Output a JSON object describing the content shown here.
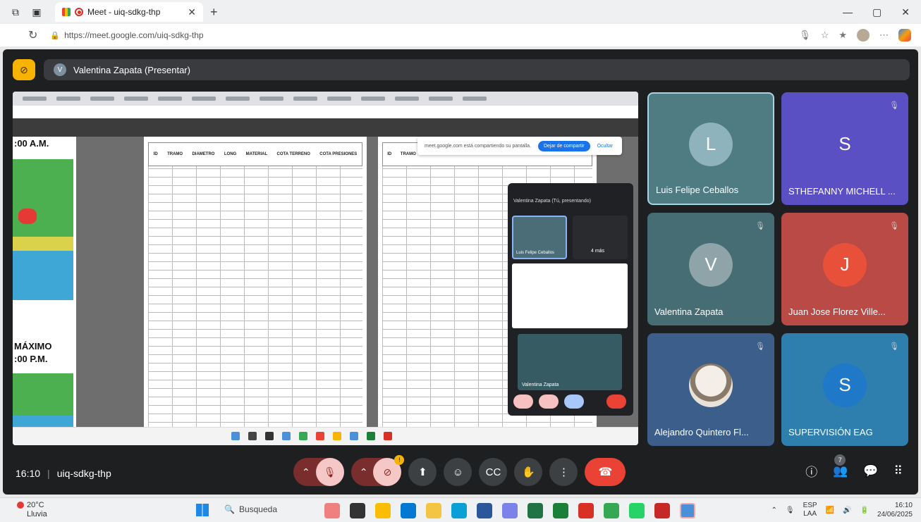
{
  "browser": {
    "tab_title": "Meet - uiq-sdkg-thp",
    "url": "https://meet.google.com/uiq-sdkg-thp"
  },
  "meet": {
    "presenter_label": "Valentina Zapata (Presentar)",
    "presenter_initial": "V",
    "time": "16:10",
    "meeting_code": "uiq-sdkg-thp",
    "people_count": "7",
    "reactions_badge": "!"
  },
  "shared_screen": {
    "heading_1": ":00 A.M.",
    "heading_2": "MÁXIMO",
    "heading_3": ":00 P.M.",
    "share_notice": "meet.google.com está compartiendo su pantalla.",
    "stop_share": "Dejar de compartir",
    "hide": "Ocultar",
    "mini_presenter": "Valentina Zapata (Tú, presentando)",
    "mini_tile_name": "Luis Felipe Ceballos",
    "mini_more": "4 más",
    "mini_self_name": "Valentina Zapata",
    "table_headers": [
      "ID",
      "TRAMO",
      "DIAMETRO",
      "LONG",
      "MATERIAL",
      "COTA TERRENO",
      "COTA PRESIONES"
    ]
  },
  "participants": [
    {
      "name": "Luis Felipe Ceballos",
      "initial": "L",
      "bg": "#4f7b83",
      "avatar": "#8fb3bd",
      "muted": false
    },
    {
      "name": "STHEFANNY MICHELL ...",
      "initial": "S",
      "bg": "#5b4fc4",
      "avatar": "#5b4fc4",
      "muted": true
    },
    {
      "name": "Valentina Zapata",
      "initial": "V",
      "bg": "#466d74",
      "avatar": "#8ea4a8",
      "muted": true
    },
    {
      "name": "Juan Jose Florez Ville...",
      "initial": "J",
      "bg": "#b94a45",
      "avatar": "#e8503a",
      "muted": true
    },
    {
      "name": "Alejandro Quintero Fl...",
      "initial": "",
      "bg": "#3b5f8a",
      "avatar": "#d9d2c6",
      "muted": true
    },
    {
      "name": "SUPERVISIÓN EAG",
      "initial": "S",
      "bg": "#2f7fae",
      "avatar": "#1f78c8",
      "muted": true
    }
  ],
  "taskbar": {
    "temperature": "20°C",
    "weather": "Lluvia",
    "search_placeholder": "Busqueda",
    "lang_1": "ESP",
    "lang_2": "LAA",
    "clock_time": "16:10",
    "clock_date": "24/06/2025"
  },
  "colors": {
    "meet_bg": "#1e1f21",
    "end_call": "#ea4335",
    "cam_off_accent": "#f6b400"
  }
}
